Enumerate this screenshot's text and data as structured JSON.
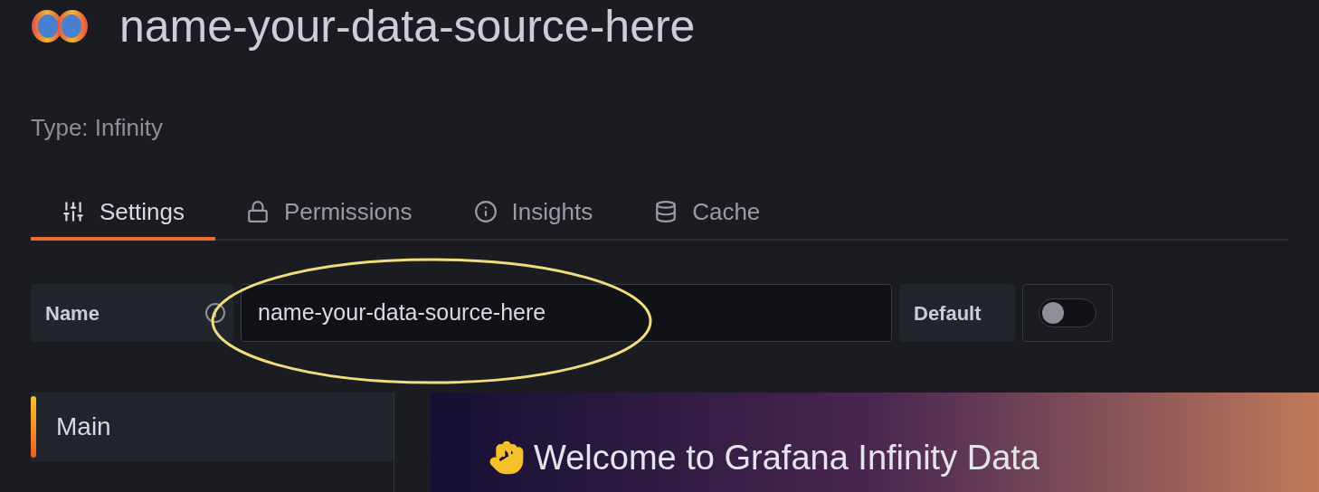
{
  "title": "name-your-data-source-here",
  "type_label": "Type: Infinity",
  "tabs": [
    {
      "label": "Settings",
      "kind": "settings",
      "selected": true
    },
    {
      "label": "Permissions",
      "kind": "permissions",
      "selected": false
    },
    {
      "label": "Insights",
      "kind": "insights",
      "selected": false
    },
    {
      "label": "Cache",
      "kind": "cache",
      "selected": false
    }
  ],
  "name_field": {
    "label": "Name",
    "value": "name-your-data-source-here"
  },
  "default_toggle": {
    "label": "Default",
    "on": false
  },
  "sidebar": {
    "items": [
      {
        "label": "Main",
        "selected": true
      }
    ]
  },
  "banner": {
    "heading": "Welcome to Grafana Infinity Data"
  }
}
